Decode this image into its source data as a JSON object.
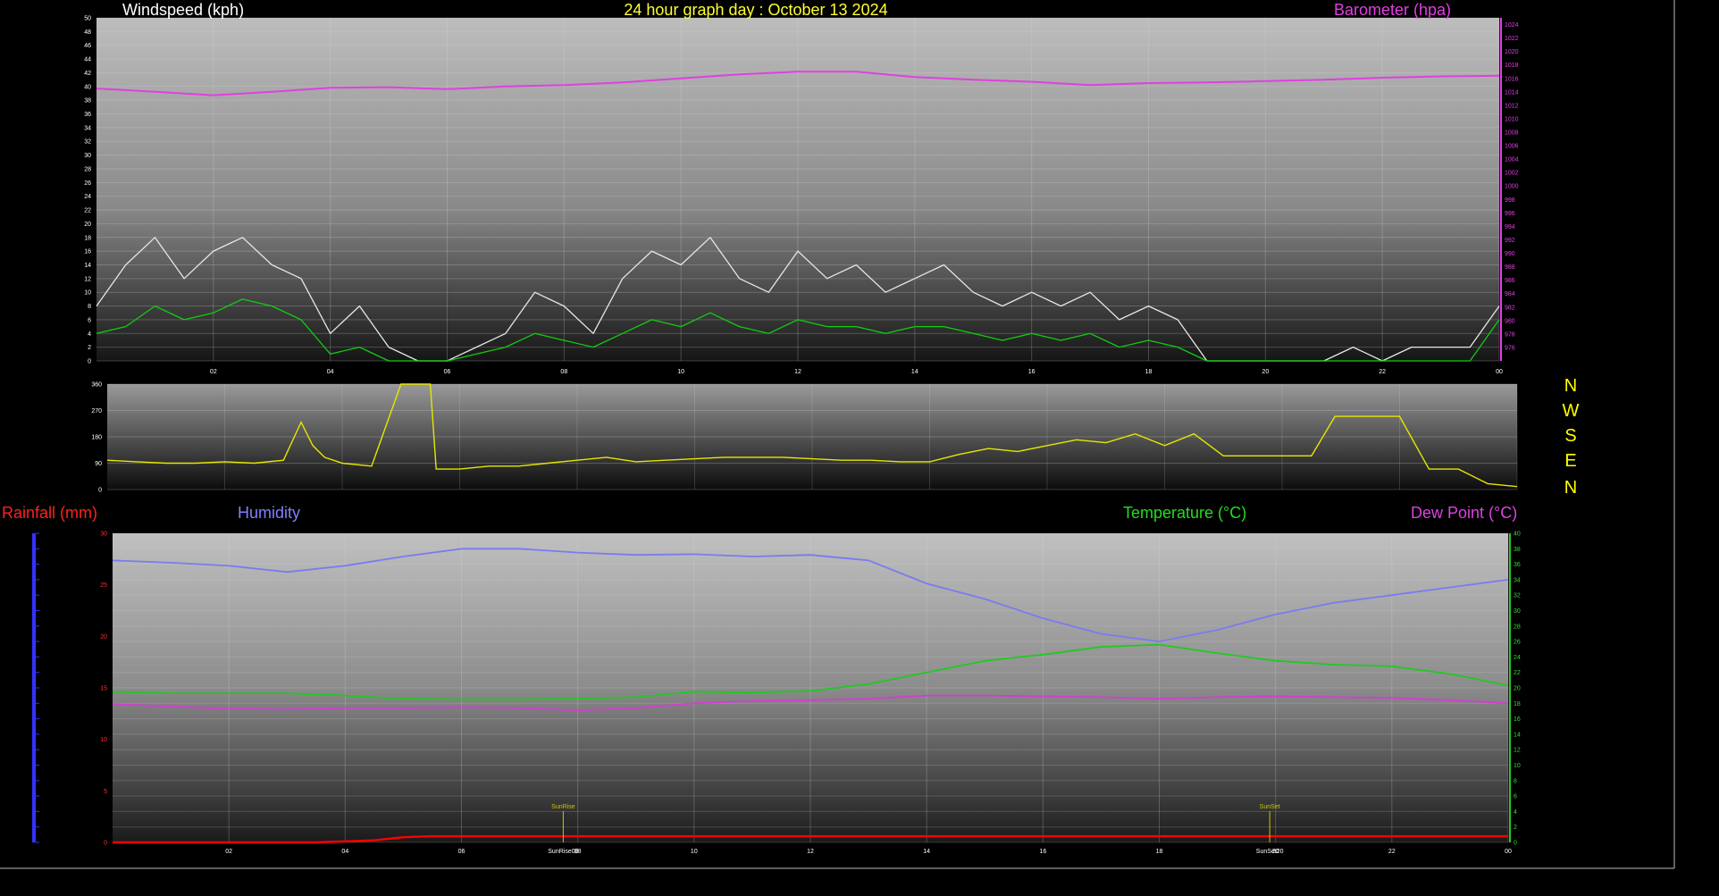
{
  "colors": {
    "background": "#000000",
    "wind": "#e6e6e6",
    "wind_avg": "#11cc11",
    "barometer": "#e040e0",
    "wind_dir": "#e6e600",
    "humidity": "#7b7bf0",
    "temperature": "#22c822",
    "dew_point": "#d43cd4",
    "rainfall": "#ff0000",
    "sun_marker": "#c8c800"
  },
  "header": {
    "windspeed_label": "Windspeed (kph)",
    "title": "24 hour graph day : October 13 2024",
    "barometer_label": "Barometer (hpa)"
  },
  "lower_labels": {
    "rainfall": "Rainfall (mm)",
    "humidity": "Humidity",
    "temperature": "Temperature (°C)",
    "dew_point": "Dew Point (°C)"
  },
  "chart_data": [
    {
      "type": "line",
      "panel": "wind",
      "x_ticks": [
        "02",
        "04",
        "06",
        "08",
        "10",
        "12",
        "14",
        "16",
        "18",
        "20",
        "22",
        "00"
      ],
      "ylabel": "Windspeed (kph)",
      "ylim": [
        0,
        50
      ],
      "y_ticks": [
        0,
        2,
        4,
        6,
        8,
        10,
        12,
        14,
        16,
        18,
        20,
        22,
        24,
        26,
        28,
        30,
        32,
        34,
        36,
        38,
        40,
        42,
        44,
        46,
        48,
        50
      ],
      "y2label": "Barometer (hpa)",
      "y2lim": [
        974,
        1025
      ],
      "y2_ticks": [
        976,
        978,
        980,
        982,
        984,
        986,
        988,
        990,
        992,
        994,
        996,
        998,
        1000,
        1002,
        1004,
        1006,
        1008,
        1010,
        1012,
        1014,
        1016,
        1018,
        1020,
        1022,
        1024
      ],
      "grid": true,
      "series": [
        {
          "name": "Gust",
          "axis": "left",
          "x": [
            0,
            0.5,
            1,
            1.5,
            2,
            2.5,
            3,
            3.5,
            4,
            4.5,
            5,
            5.5,
            6,
            6.5,
            7,
            7.5,
            8,
            8.5,
            9,
            9.5,
            10,
            10.5,
            11,
            11.5,
            12,
            12.5,
            13,
            13.5,
            14,
            14.5,
            15,
            15.5,
            16,
            16.5,
            17,
            17.5,
            18,
            18.5,
            19,
            19.5,
            20,
            20.5,
            21,
            21.5,
            22,
            22.5,
            23,
            23.5,
            24
          ],
          "values": [
            8,
            14,
            18,
            12,
            16,
            18,
            14,
            12,
            4,
            8,
            2,
            0,
            0,
            2,
            4,
            10,
            8,
            4,
            12,
            16,
            14,
            18,
            12,
            10,
            16,
            12,
            14,
            10,
            12,
            14,
            10,
            8,
            10,
            8,
            10,
            6,
            8,
            6,
            0,
            0,
            0,
            0,
            0,
            2,
            0,
            2,
            2,
            2,
            8
          ]
        },
        {
          "name": "Average",
          "axis": "left",
          "x": [
            0,
            0.5,
            1,
            1.5,
            2,
            2.5,
            3,
            3.5,
            4,
            4.5,
            5,
            5.5,
            6,
            6.5,
            7,
            7.5,
            8,
            8.5,
            9,
            9.5,
            10,
            10.5,
            11,
            11.5,
            12,
            12.5,
            13,
            13.5,
            14,
            14.5,
            15,
            15.5,
            16,
            16.5,
            17,
            17.5,
            18,
            18.5,
            19,
            19.5,
            20,
            20.5,
            21,
            21.5,
            22,
            22.5,
            23,
            23.5,
            24
          ],
          "values": [
            4,
            5,
            8,
            6,
            7,
            9,
            8,
            6,
            1,
            2,
            0,
            0,
            0,
            1,
            2,
            4,
            3,
            2,
            4,
            6,
            5,
            7,
            5,
            4,
            6,
            5,
            5,
            4,
            5,
            5,
            4,
            3,
            4,
            3,
            4,
            2,
            3,
            2,
            0,
            0,
            0,
            0,
            0,
            0,
            0,
            0,
            0,
            0,
            6
          ]
        },
        {
          "name": "Barometer",
          "axis": "right",
          "x": [
            0,
            1,
            2,
            3,
            4,
            5,
            6,
            7,
            8,
            9,
            10,
            11,
            12,
            13,
            14,
            15,
            16,
            17,
            18,
            19,
            20,
            21,
            22,
            23,
            24
          ],
          "values": [
            1014.5,
            1014,
            1013.5,
            1014,
            1014.6,
            1014.7,
            1014.4,
            1014.8,
            1015,
            1015.4,
            1016,
            1016.6,
            1017,
            1017,
            1016.2,
            1015.8,
            1015.5,
            1015,
            1015.3,
            1015.4,
            1015.6,
            1015.8,
            1016.1,
            1016.3,
            1016.4
          ]
        }
      ]
    },
    {
      "type": "line",
      "panel": "wind-direction",
      "x_ticks": [],
      "ylim": [
        0,
        360
      ],
      "y_ticks": [
        0,
        90,
        180,
        270,
        360
      ],
      "compass_labels": [
        "N",
        "W",
        "S",
        "E",
        "N"
      ],
      "grid": true,
      "series": [
        {
          "name": "Direction",
          "x": [
            0,
            0.5,
            1,
            1.5,
            2,
            2.5,
            3,
            3.3,
            3.5,
            3.7,
            4,
            4.5,
            5,
            5.5,
            5.6,
            6,
            6.5,
            7,
            7.5,
            8,
            8.5,
            9,
            9.5,
            10,
            10.5,
            11,
            11.5,
            12,
            12.5,
            13,
            13.5,
            14,
            14.5,
            15,
            15.5,
            16,
            16.5,
            17,
            17.5,
            18,
            18.5,
            19,
            19.5,
            20,
            20.5,
            20.9,
            21.5,
            22,
            22.5,
            23,
            23.5,
            24
          ],
          "values": [
            100,
            95,
            90,
            90,
            95,
            90,
            100,
            230,
            150,
            110,
            90,
            80,
            360,
            360,
            70,
            70,
            80,
            80,
            90,
            100,
            110,
            95,
            100,
            105,
            110,
            110,
            110,
            105,
            100,
            100,
            95,
            95,
            120,
            140,
            130,
            150,
            170,
            160,
            190,
            150,
            190,
            115,
            115,
            115,
            115,
            250,
            250,
            250,
            70,
            70,
            20,
            10
          ]
        }
      ]
    },
    {
      "type": "line",
      "panel": "temperature-humidity-rain",
      "x_ticks": [
        "02",
        "04",
        "06",
        "08",
        "10",
        "12",
        "14",
        "16",
        "18",
        "20",
        "22",
        "00"
      ],
      "ylabel": "Rainfall (mm)",
      "ylim": [
        0,
        30
      ],
      "y_ticks": [
        0,
        5,
        10,
        15,
        20,
        25,
        30
      ],
      "y2lim": [
        0,
        40
      ],
      "y2_ticks": [
        0,
        2,
        4,
        6,
        8,
        10,
        12,
        14,
        16,
        18,
        20,
        22,
        24,
        26,
        28,
        30,
        32,
        34,
        36,
        38,
        40
      ],
      "grid": true,
      "annotations": [
        "SunRise",
        "SunSet"
      ],
      "x_tick_annotations": [
        "SunRise08",
        "SunSet20"
      ],
      "series": [
        {
          "name": "Humidity",
          "axis": "right",
          "x": [
            0,
            1,
            2,
            3,
            4,
            5,
            6,
            7,
            8,
            9,
            10,
            11,
            12,
            13,
            14,
            15,
            16,
            17,
            18,
            19,
            20,
            21,
            22,
            23,
            24
          ],
          "values": [
            36.5,
            36.2,
            35.8,
            35,
            35.8,
            37,
            38,
            38,
            37.5,
            37.2,
            37.3,
            37,
            37.2,
            36.5,
            33.5,
            31.5,
            29,
            27,
            26,
            27.5,
            29.5,
            31,
            32,
            33,
            34
          ]
        },
        {
          "name": "Temperature",
          "axis": "right",
          "x": [
            0,
            1,
            2,
            3,
            4,
            5,
            6,
            7,
            8,
            9,
            10,
            11,
            12,
            13,
            14,
            15,
            16,
            17,
            18,
            19,
            20,
            21,
            22,
            23,
            24
          ],
          "values": [
            19.5,
            19.3,
            19.3,
            19.3,
            19,
            18.6,
            18.5,
            18.5,
            18.6,
            18.8,
            19.5,
            19.4,
            19.6,
            20.5,
            22,
            23.5,
            24.3,
            25.3,
            25.6,
            24.5,
            23.5,
            23,
            22.8,
            21.8,
            20.3
          ]
        },
        {
          "name": "Dew Point",
          "axis": "right",
          "x": [
            0,
            1,
            2,
            3,
            4,
            5,
            6,
            7,
            8,
            9,
            10,
            11,
            12,
            13,
            14,
            15,
            16,
            17,
            18,
            19,
            20,
            21,
            22,
            23,
            24
          ],
          "values": [
            17.9,
            17.6,
            17.3,
            17.2,
            17.4,
            17.4,
            17.5,
            17.4,
            17.1,
            17.4,
            18,
            18.3,
            18.4,
            18.6,
            19,
            19,
            18.9,
            18.8,
            18.6,
            18.8,
            18.9,
            18.8,
            18.7,
            18.4,
            18
          ]
        },
        {
          "name": "Rainfall",
          "axis": "left",
          "x": [
            0,
            3.5,
            4.5,
            5,
            5.5,
            24
          ],
          "values": [
            0,
            0,
            0.2,
            0.5,
            0.6,
            0.6
          ]
        }
      ]
    }
  ]
}
